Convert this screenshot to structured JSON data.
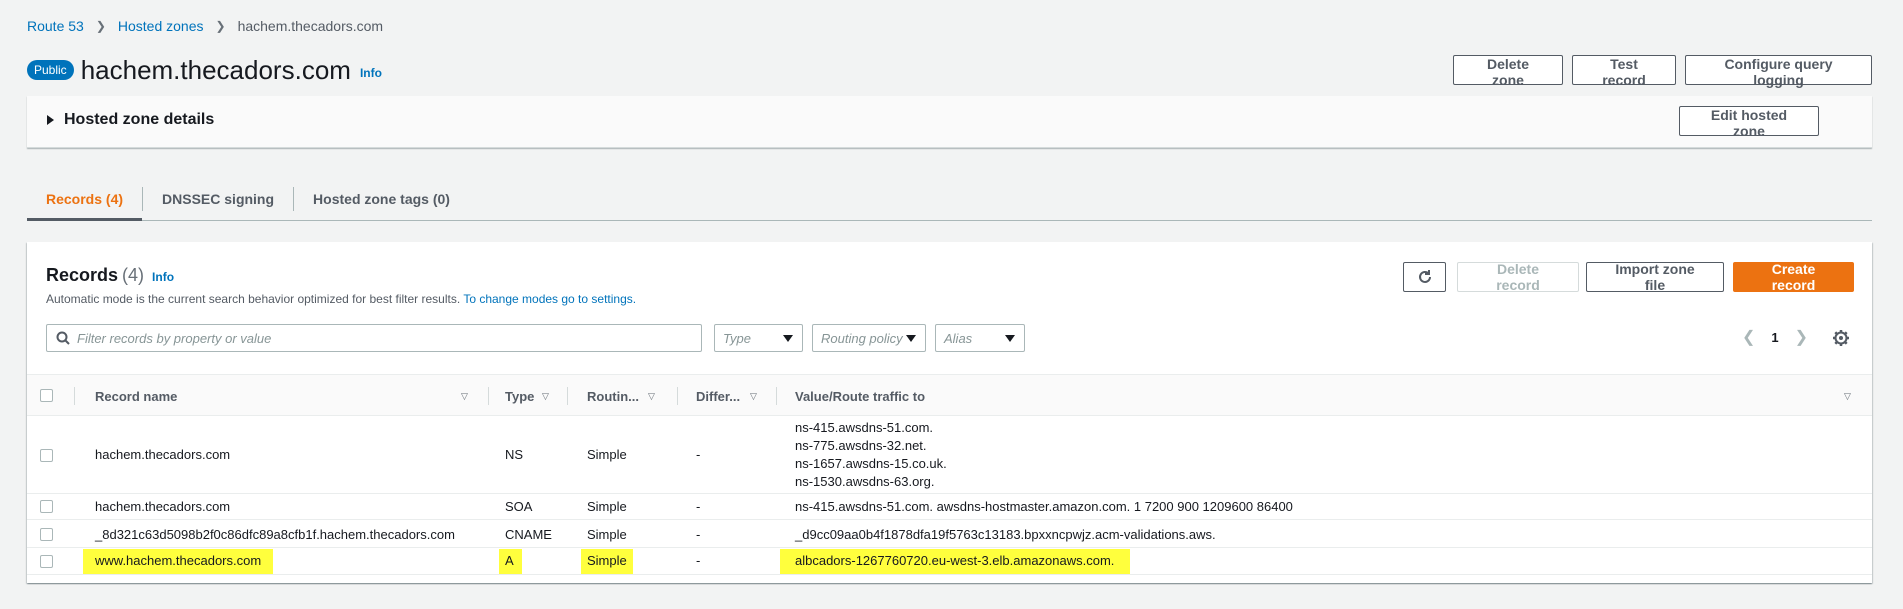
{
  "breadcrumb": {
    "items": [
      "Route 53",
      "Hosted zones"
    ],
    "current": "hachem.thecadors.com"
  },
  "header": {
    "badge": "Public",
    "title": "hachem.thecadors.com",
    "info": "Info",
    "buttons": {
      "delete_zone": "Delete zone",
      "test_record": "Test record",
      "configure_logging": "Configure query logging"
    }
  },
  "details": {
    "title": "Hosted zone details",
    "edit_button": "Edit hosted zone"
  },
  "tabs": [
    {
      "label": "Records (4)",
      "active": true
    },
    {
      "label": "DNSSEC signing",
      "active": false
    },
    {
      "label": "Hosted zone tags (0)",
      "active": false
    }
  ],
  "records": {
    "title": "Records",
    "count": "(4)",
    "info": "Info",
    "description": "Automatic mode is the current search behavior optimized for best filter results.",
    "description_link": "To change modes go to settings.",
    "buttons": {
      "delete_record": "Delete record",
      "import_zone": "Import zone file",
      "create_record": "Create record"
    },
    "filter_placeholder": "Filter records by property or value",
    "selects": {
      "type": "Type",
      "routing": "Routing policy",
      "alias": "Alias"
    },
    "page": "1",
    "columns": {
      "name": "Record name",
      "type": "Type",
      "routing": "Routin...",
      "differ": "Differ...",
      "value": "Value/Route traffic to"
    },
    "rows": [
      {
        "name": "hachem.thecadors.com",
        "type": "NS",
        "routing": "Simple",
        "differ": "-",
        "values": [
          "ns-415.awsdns-51.com.",
          "ns-775.awsdns-32.net.",
          "ns-1657.awsdns-15.co.uk.",
          "ns-1530.awsdns-63.org."
        ]
      },
      {
        "name": "hachem.thecadors.com",
        "type": "SOA",
        "routing": "Simple",
        "differ": "-",
        "values": [
          "ns-415.awsdns-51.com. awsdns-hostmaster.amazon.com. 1 7200 900 1209600 86400"
        ]
      },
      {
        "name": "_8d321c63d5098b2f0c86dfc89a8cfb1f.hachem.thecadors.com",
        "type": "CNAME",
        "routing": "Simple",
        "differ": "-",
        "values": [
          "_d9cc09aa0b4f1878dfa19f5763c13183.bpxxncpwjz.acm-validations.aws."
        ]
      },
      {
        "name": "www.hachem.thecadors.com",
        "type": "A",
        "routing": "Simple",
        "differ": "-",
        "values": [
          "albcadors-1267760720.eu-west-3.elb.amazonaws.com."
        ]
      }
    ]
  },
  "colors": {
    "link": "#0073bb",
    "primary": "#ec7211",
    "highlight": "#ffff3d"
  }
}
